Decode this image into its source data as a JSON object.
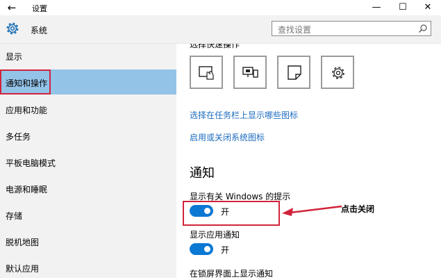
{
  "window": {
    "title": "设置",
    "back_icon": "back-arrow-icon",
    "minimize": "—",
    "maximize": "☐",
    "close": "✕"
  },
  "header": {
    "title": "系统",
    "search_placeholder": "查找设置",
    "icon": "gear-icon"
  },
  "sidebar": {
    "items": [
      {
        "label": "显示"
      },
      {
        "label": "通知和操作"
      },
      {
        "label": "应用和功能"
      },
      {
        "label": "多任务"
      },
      {
        "label": "平板电脑模式"
      },
      {
        "label": "电源和睡眠"
      },
      {
        "label": "存储"
      },
      {
        "label": "脱机地图"
      },
      {
        "label": "默认应用"
      }
    ],
    "active_index": 1
  },
  "main": {
    "quick_actions_heading": "选择快速操作",
    "quick_action_tiles": [
      "tablet-mode-icon",
      "project-icon",
      "note-icon",
      "settings-icon"
    ],
    "links": [
      "选择在任务栏上显示哪些图标",
      "启用或关闭系统图标"
    ],
    "notifications_title": "通知",
    "settings": [
      {
        "label": "显示有关 Windows 的提示",
        "state": "开",
        "on": true
      },
      {
        "label": "显示应用通知",
        "state": "开",
        "on": true
      }
    ],
    "partial_label": "在锁屏界面上显示通知",
    "annotation": "点击关闭"
  },
  "colors": {
    "accent": "#0b78d4",
    "link": "#1c6bbf",
    "sidebar_active": "#94c3e8",
    "highlight_red": "#d0243b"
  }
}
